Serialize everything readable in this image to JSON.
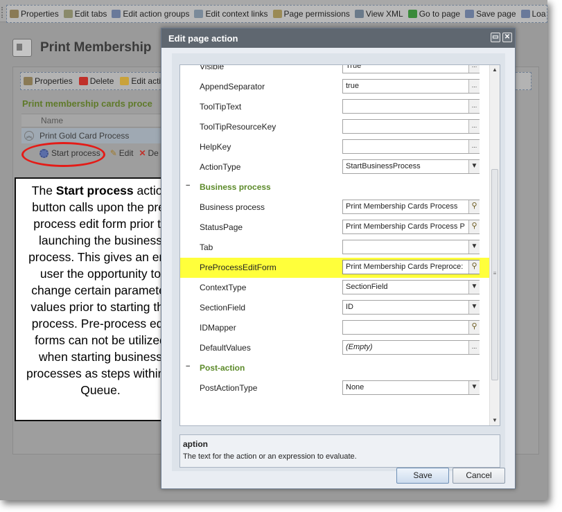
{
  "top_toolbar": {
    "items": [
      {
        "label": "Properties",
        "icon": "properties-icon"
      },
      {
        "label": "Edit tabs",
        "icon": "edit-tabs-icon"
      },
      {
        "label": "Edit action groups",
        "icon": "action-groups-icon"
      },
      {
        "label": "Edit context links",
        "icon": "context-links-icon"
      },
      {
        "label": "Page permissions",
        "icon": "permissions-icon"
      },
      {
        "label": "View XML",
        "icon": "xml-icon"
      },
      {
        "label": "Go to page",
        "icon": "go-icon"
      },
      {
        "label": "Save page",
        "icon": "save-icon"
      },
      {
        "label": "Loa",
        "icon": "load-icon"
      }
    ]
  },
  "page": {
    "title": "Print Membership"
  },
  "panel_toolbar": {
    "items": [
      {
        "label": "Properties",
        "icon": "properties-icon"
      },
      {
        "label": "Delete",
        "icon": "delete-icon"
      },
      {
        "label": "Edit actio",
        "icon": "edit-action-icon"
      }
    ]
  },
  "section": {
    "title": "Print membership cards proce"
  },
  "grid": {
    "header": "Name",
    "row": "Print Gold Card Process",
    "actions": {
      "start": "Start process",
      "edit": "Edit",
      "delete": "De"
    }
  },
  "callout": {
    "lead": "The ",
    "bold": "Start process",
    "rest": " action button calls upon the pre-process edit form prior to launching the business process. This gives an end user the opportunity to change certain parameter values prior to starting the process. Pre-process edit forms can not be utilized when starting business processes as steps within a Queue."
  },
  "dialog": {
    "title": "Edit page action",
    "properties": [
      {
        "label": "Visible",
        "value": "True",
        "button": "...",
        "type": "prop"
      },
      {
        "label": "AppendSeparator",
        "value": "true",
        "button": "...",
        "type": "prop"
      },
      {
        "label": "ToolTipText",
        "value": "",
        "button": "...",
        "type": "prop"
      },
      {
        "label": "ToolTipResourceKey",
        "value": "",
        "button": "...",
        "type": "prop"
      },
      {
        "label": "HelpKey",
        "value": "",
        "button": "...",
        "type": "prop"
      },
      {
        "label": "ActionType",
        "value": "StartBusinessProcess",
        "button": "▼",
        "type": "prop"
      },
      {
        "label": "Business process",
        "type": "category",
        "toggle": "−"
      },
      {
        "label": "Business process",
        "value": "Print Membership Cards Process",
        "button": "lookup",
        "type": "prop"
      },
      {
        "label": "StatusPage",
        "value": "Print Membership Cards Process P",
        "button": "lookup",
        "type": "prop"
      },
      {
        "label": "Tab",
        "value": "",
        "button": "▼",
        "type": "prop"
      },
      {
        "label": "PreProcessEditForm",
        "value": "Print Membership Cards Preproce:",
        "button": "lookup",
        "type": "prop",
        "highlight": true
      },
      {
        "label": "ContextType",
        "value": "SectionField",
        "button": "▼",
        "type": "prop"
      },
      {
        "label": "SectionField",
        "value": "ID",
        "button": "▼",
        "type": "prop"
      },
      {
        "label": "IDMapper",
        "value": "",
        "button": "lookup",
        "type": "prop"
      },
      {
        "label": "DefaultValues",
        "value": "(Empty)",
        "button": "...",
        "type": "prop",
        "italic": true
      },
      {
        "label": "Post-action",
        "type": "category",
        "toggle": "−"
      },
      {
        "label": "PostActionType",
        "value": "None",
        "button": "▼",
        "type": "prop"
      }
    ],
    "description": {
      "title": "aption",
      "text": "The text for the action or an expression to evaluate."
    },
    "save_label": "Save",
    "cancel_label": "Cancel",
    "scroll_grip": "≡"
  },
  "colors": {
    "highlight": "#ffff3b",
    "category_text": "#5c8a2a",
    "callout_circle": "#e41b17",
    "dialog_title_bar": "#5f6770"
  }
}
